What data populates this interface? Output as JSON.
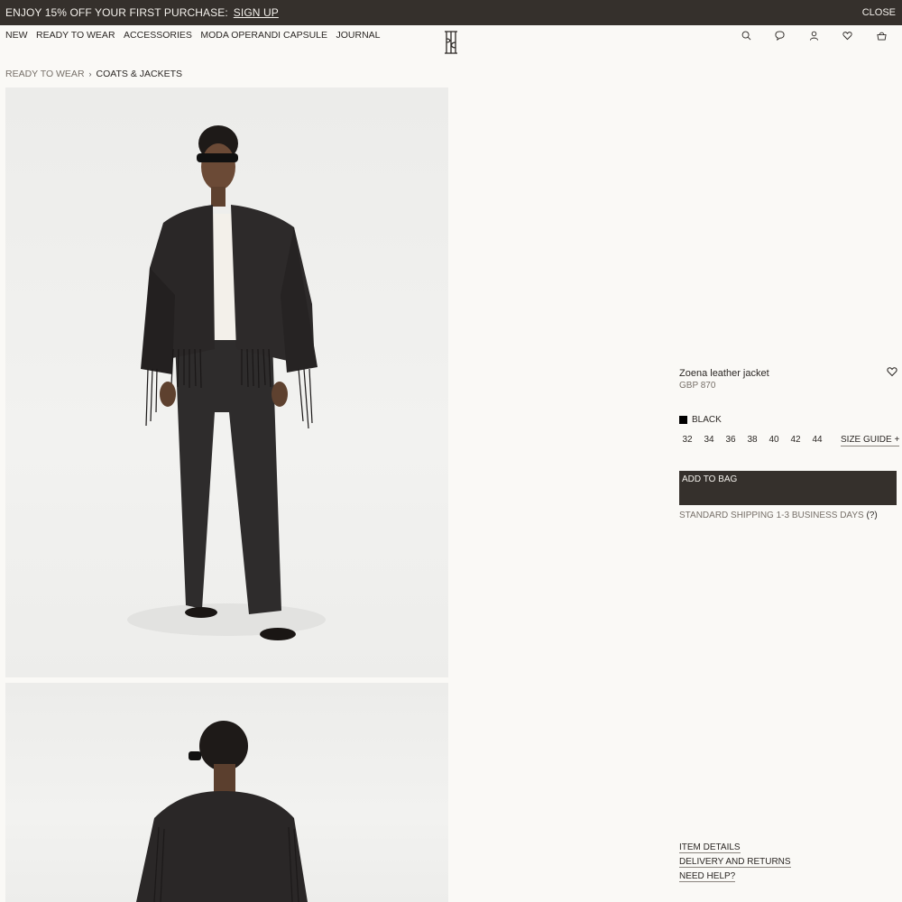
{
  "promo": {
    "message": "ENJOY 15% OFF YOUR FIRST PURCHASE:",
    "cta": "SIGN UP",
    "close": "CLOSE"
  },
  "nav": {
    "items": [
      "NEW",
      "READY TO WEAR",
      "ACCESSORIES",
      "MODA OPERANDI CAPSULE",
      "JOURNAL"
    ],
    "icons": [
      "search-icon",
      "chat-icon",
      "account-icon",
      "wishlist-icon",
      "bag-icon"
    ]
  },
  "breadcrumb": {
    "parent": "READY TO WEAR",
    "separator": "›",
    "current": "COATS & JACKETS"
  },
  "product": {
    "name": "Zoena leather jacket",
    "price": "GBP 870",
    "color": "BLACK",
    "color_hex": "#000000",
    "sizes": [
      "32",
      "34",
      "36",
      "38",
      "40",
      "42",
      "44"
    ],
    "size_guide": "SIZE GUIDE +",
    "add_to_bag": "ADD TO BAG",
    "shipping": "STANDARD SHIPPING 1-3 BUSINESS DAYS",
    "shipping_help": "(?)"
  },
  "footer_links": [
    "ITEM DETAILS",
    "DELIVERY AND RETURNS",
    "NEED HELP?"
  ],
  "colors": {
    "bar": "#35302c",
    "background": "#faf9f6",
    "text": "#2b2724",
    "muted": "#777069"
  }
}
